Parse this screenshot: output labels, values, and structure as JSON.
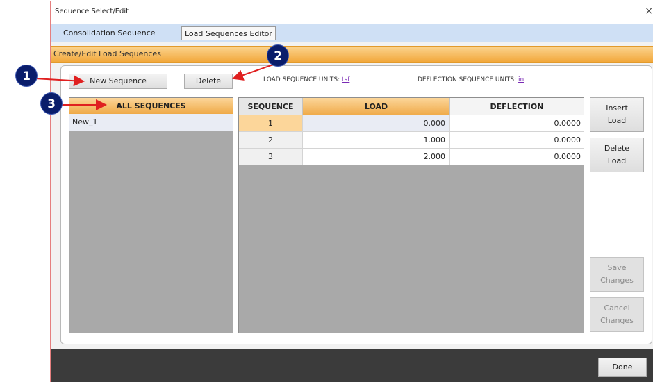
{
  "window": {
    "title": "Sequence Select/Edit",
    "close_glyph": "×"
  },
  "tabs": [
    {
      "label": "Consolidation Sequence",
      "active": false
    },
    {
      "label": "Load Sequences Editor",
      "active": true
    }
  ],
  "section": {
    "title": "Create/Edit Load Sequences"
  },
  "toolbar": {
    "new_sequence_label": "New Sequence",
    "delete_label": "Delete",
    "load_units_label": "LOAD SEQUENCE UNITS:",
    "load_units_value": "tsf",
    "deflection_units_label": "DEFLECTION SEQUENCE UNITS:",
    "deflection_units_value": "in"
  },
  "sequences_list": {
    "header": "ALL SEQUENCES",
    "items": [
      "New_1"
    ]
  },
  "grid": {
    "columns": [
      "SEQUENCE",
      "LOAD",
      "DEFLECTION"
    ],
    "rows": [
      {
        "sequence": "1",
        "load": "0.000",
        "deflection": "0.0000"
      },
      {
        "sequence": "2",
        "load": "1.000",
        "deflection": "0.0000"
      },
      {
        "sequence": "3",
        "load": "2.000",
        "deflection": "0.0000"
      }
    ]
  },
  "side_buttons": {
    "insert": {
      "line1": "Insert",
      "line2": "Load"
    },
    "delete": {
      "line1": "Delete",
      "line2": "Load"
    },
    "save": {
      "line1": "Save",
      "line2": "Changes"
    },
    "cancel": {
      "line1": "Cancel",
      "line2": "Changes"
    }
  },
  "footer": {
    "done_label": "Done"
  },
  "annotations": {
    "marker1": "1",
    "marker2": "2",
    "marker3": "3",
    "color": "#0a1d6b",
    "arrow_color": "#e02020"
  },
  "colors": {
    "accent_orange": "#f2a83c",
    "tab_blue": "#cfe0f5",
    "grid_gray": "#a9a9a9",
    "footer_dark": "#3b3b3b"
  }
}
